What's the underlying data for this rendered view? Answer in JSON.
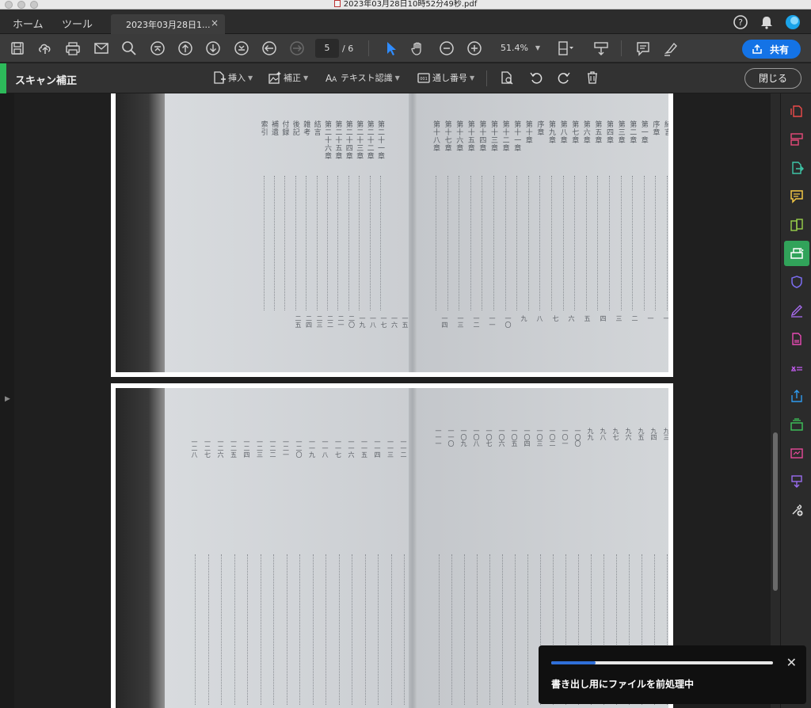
{
  "window": {
    "title": "2023年03月28日10時52分49秒.pdf"
  },
  "tabs": {
    "home": "ホーム",
    "tools": "ツール",
    "document": "2023年03月28日1...",
    "close": "×"
  },
  "toolbar": {
    "current_page": "5",
    "page_total": "/ 6",
    "zoom": "51.4%",
    "share_label": "共有"
  },
  "scan": {
    "title": "スキャン補正",
    "insert": "挿入",
    "enhance": "補正",
    "ocr": "テキスト認識",
    "bates": "通し番号",
    "close": "閉じる"
  },
  "toast": {
    "message": "書き出し用にファイルを前処理中",
    "progress": 0.2
  },
  "page1": {
    "right_columns": [
      "緒言",
      "序章",
      "第一章",
      "第二章",
      "第三章",
      "第四章",
      "第五章",
      "第六章",
      "第七章",
      "第八章",
      "第九章",
      "序章",
      "第十章",
      "第十一章",
      "第十二章",
      "第十三章",
      "第十四章",
      "第十五章",
      "第十六章",
      "第十七章",
      "第十八章"
    ],
    "left_columns": [
      "第二十一章",
      "第二十二章",
      "第二十三章",
      "第二十四章",
      "第二十五章",
      "第二十六章",
      "結言",
      "雑考",
      "後記",
      "付録",
      "補遺",
      "索引"
    ],
    "right_numbers": [
      "一",
      "一",
      "二",
      "三",
      "四",
      "五",
      "六",
      "七",
      "八",
      "九",
      "一〇",
      "一一",
      "一二",
      "一三",
      "一四"
    ],
    "left_numbers": [
      "一五",
      "一六",
      "一七",
      "一八",
      "一九",
      "二〇",
      "二一",
      "二二",
      "二三",
      "二四",
      "二五"
    ]
  },
  "page2": {
    "right_numbers": [
      "九三",
      "九四",
      "九五",
      "九六",
      "九七",
      "九八",
      "九九",
      "一〇〇",
      "一〇一",
      "一〇二",
      "一〇三",
      "一〇四",
      "一〇五",
      "一〇六",
      "一〇七",
      "一〇八",
      "一〇九",
      "一一〇",
      "一一一"
    ],
    "left_numbers": [
      "一一二",
      "一一三",
      "一一四",
      "一一五",
      "一一六",
      "一一七",
      "一一八",
      "一一九",
      "一二〇",
      "一二一",
      "一二二",
      "一二三",
      "一二四",
      "一二五",
      "一二六",
      "一二七",
      "一二八"
    ]
  }
}
